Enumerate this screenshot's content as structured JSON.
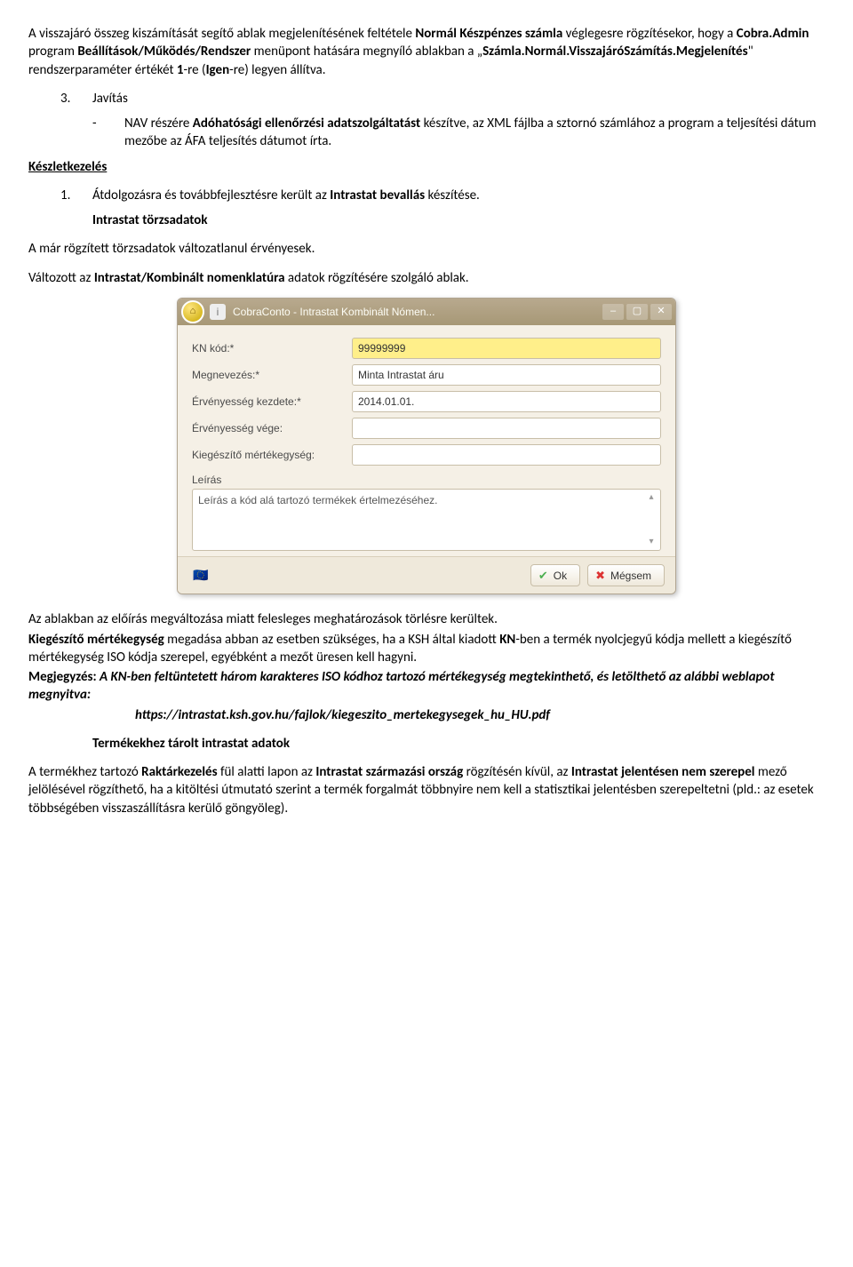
{
  "para1_a": "A visszajáró összeg kiszámítását segítő ablak megjelenítésének feltétele ",
  "para1_b": "Normál Készpénzes számla",
  "para1_c": " véglegesre rögzítésekor, hogy a ",
  "para1_d": "Cobra.Admin",
  "para1_e": " program ",
  "para1_f": "Beállítások/Működés/Rendszer",
  "para1_g": " menüpont hatására megnyíló ablakban a „",
  "para1_h": "Számla.Normál.VisszajáróSzámítás.Megjelenítés",
  "para1_i": "\" rendszerparaméter értékét ",
  "para1_j": "1",
  "para1_k": "-re (",
  "para1_l": "Igen",
  "para1_m": "-re) legyen állítva.",
  "num3": "3.",
  "javitas": "Javítás",
  "bullet": "-",
  "b1_a": "NAV részére ",
  "b1_b": "Adóhatósági ellenőrzési adatszolgáltatást",
  "b1_c": " készítve, az XML fájlba a sztornó számlához a program a teljesítési dátum mezőbe az ÁFA teljesítés dátumot írta.",
  "keszlet": "Készletkezelés",
  "num1": "1.",
  "l1_a": "Átdolgozásra és továbbfejlesztésre került az ",
  "l1_b": "Intrastat bevallás",
  "l1_c": " készítése.",
  "intr_torzs": "Intrastat törzsadatok",
  "para_a": "A már rögzített törzsadatok változatlanul érvényesek.",
  "para_b_a": "Változott az ",
  "para_b_b": "Intrastat/Kombinált nomenklatúra",
  "para_b_c": " adatok rögzítésére szolgáló ablak.",
  "dialog": {
    "title": "CobraConto - Intrastat Kombinált Nómen...",
    "info": "i",
    "fields": {
      "kn_label": "KN kód:*",
      "kn_value": "99999999",
      "meg_label": "Megnevezés:*",
      "meg_value": "Minta Intrastat áru",
      "erv_k_label": "Érvényesség kezdete:*",
      "erv_k_value": "2014.01.01.",
      "erv_v_label": "Érvényesség vége:",
      "erv_v_value": "",
      "kieg_label": "Kiegészítő mértékegység:",
      "kieg_value": ""
    },
    "leiras_label": "Leírás",
    "leiras_text": "Leírás a kód alá tartozó termékek értelmezéséhez.",
    "ok": "Ok",
    "megsem": "Mégsem"
  },
  "after_a": "Az ablakban az előírás megváltozása miatt felesleges meghatározások törlésre kerültek.",
  "after_b_a": "Kiegészítő mértékegység",
  "after_b_b": " megadása abban az esetben szükséges, ha a KSH által kiadott ",
  "after_b_c": "KN",
  "after_b_d": "-ben a termék nyolcjegyű kódja mellett a kiegészítő mértékegység ISO kódja szerepel, egyébként a mezőt üresen kell hagyni.",
  "megj_label": "Megjegyzés:",
  "megj_a": " A KN-ben feltüntetett három karakteres ISO kódhoz tartozó mértékegység megtekinthető, és letölthető az alábbi weblapot megnyitva:",
  "megj_url": "https://intrastat.ksh.gov.hu/fajlok/kiegeszito_mertekegysegek_hu_HU.pdf",
  "term_head": "Termékekhez tárolt intrastat adatok",
  "last_a": "A termékhez tartozó ",
  "last_b": "Raktárkezelés",
  "last_c": " fül alatti lapon az ",
  "last_d": "Intrastat származási ország",
  "last_e": " rögzítésén kívül, az ",
  "last_f": "Intrastat jelentésen nem szerepel",
  "last_g": " mező jelölésével rögzíthető, ha a kitöltési útmutató szerint a termék forgalmát többnyire nem kell a statisztikai jelentésben szerepeltetni (pld.: az esetek többségében visszaszállításra kerülő göngyöleg)."
}
